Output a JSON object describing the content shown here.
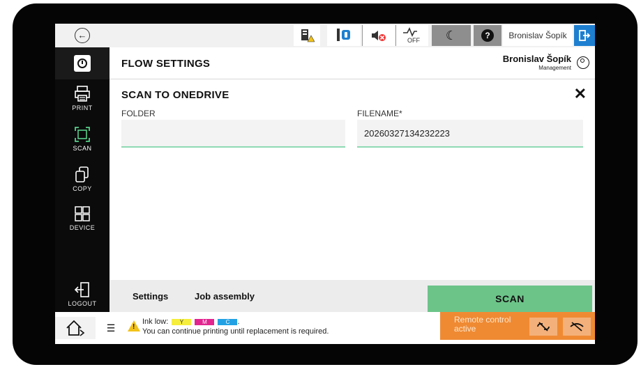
{
  "topbar": {
    "user_name": "Bronislav Šopík"
  },
  "sidebar": {
    "items": [
      {
        "label": "PRINT"
      },
      {
        "label": "SCAN"
      },
      {
        "label": "COPY"
      },
      {
        "label": "DEVICE"
      }
    ],
    "logout_label": "LOGOUT"
  },
  "header": {
    "title": "FLOW SETTINGS",
    "user_name": "Bronislav Šopík",
    "user_role": "Management"
  },
  "panel": {
    "title": "SCAN TO ONEDRIVE",
    "folder": {
      "label": "FOLDER",
      "value": ""
    },
    "filename": {
      "label": "FILENAME*",
      "value": "20260327134232223"
    }
  },
  "actions": {
    "settings_label": "Settings",
    "job_assembly_label": "Job assembly",
    "scan_label": "SCAN"
  },
  "footer": {
    "ink_prefix": "Ink low:",
    "ink_chips": [
      "Y",
      "M",
      "C"
    ],
    "ink_suffix": ".",
    "ink_message": "You can continue printing until replacement is required.",
    "remote_label": "Remote control active"
  },
  "colors": {
    "scan_button": "#6cc489",
    "remote_banner": "#ef8a33",
    "input_underline": "#8ed9b3",
    "logout_accent": "#1e7fd0"
  }
}
